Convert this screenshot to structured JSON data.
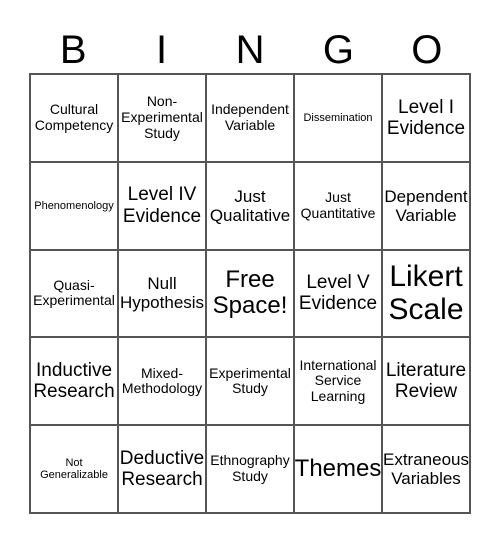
{
  "header": {
    "letters": [
      "B",
      "I",
      "N",
      "G",
      "O"
    ]
  },
  "cells": [
    [
      "Cultural Competency",
      "Non-Experimental Study",
      "Independent Variable",
      "Dissemination",
      "Level I Evidence"
    ],
    [
      "Phenomenology",
      "Level IV Evidence",
      "Just Qualitative",
      "Just Quantitative",
      "Dependent Variable"
    ],
    [
      "Quasi-Experimental",
      "Null Hypothesis",
      "Free Space!",
      "Level V Evidence",
      "Likert Scale"
    ],
    [
      "Inductive Research",
      "Mixed-Methodology",
      "Experimental Study",
      "International Service Learning",
      "Literature Review"
    ],
    [
      "Not Generalizable",
      "Deductive Research",
      "Ethnography Study",
      "Themes",
      "Extraneous Variables"
    ]
  ]
}
